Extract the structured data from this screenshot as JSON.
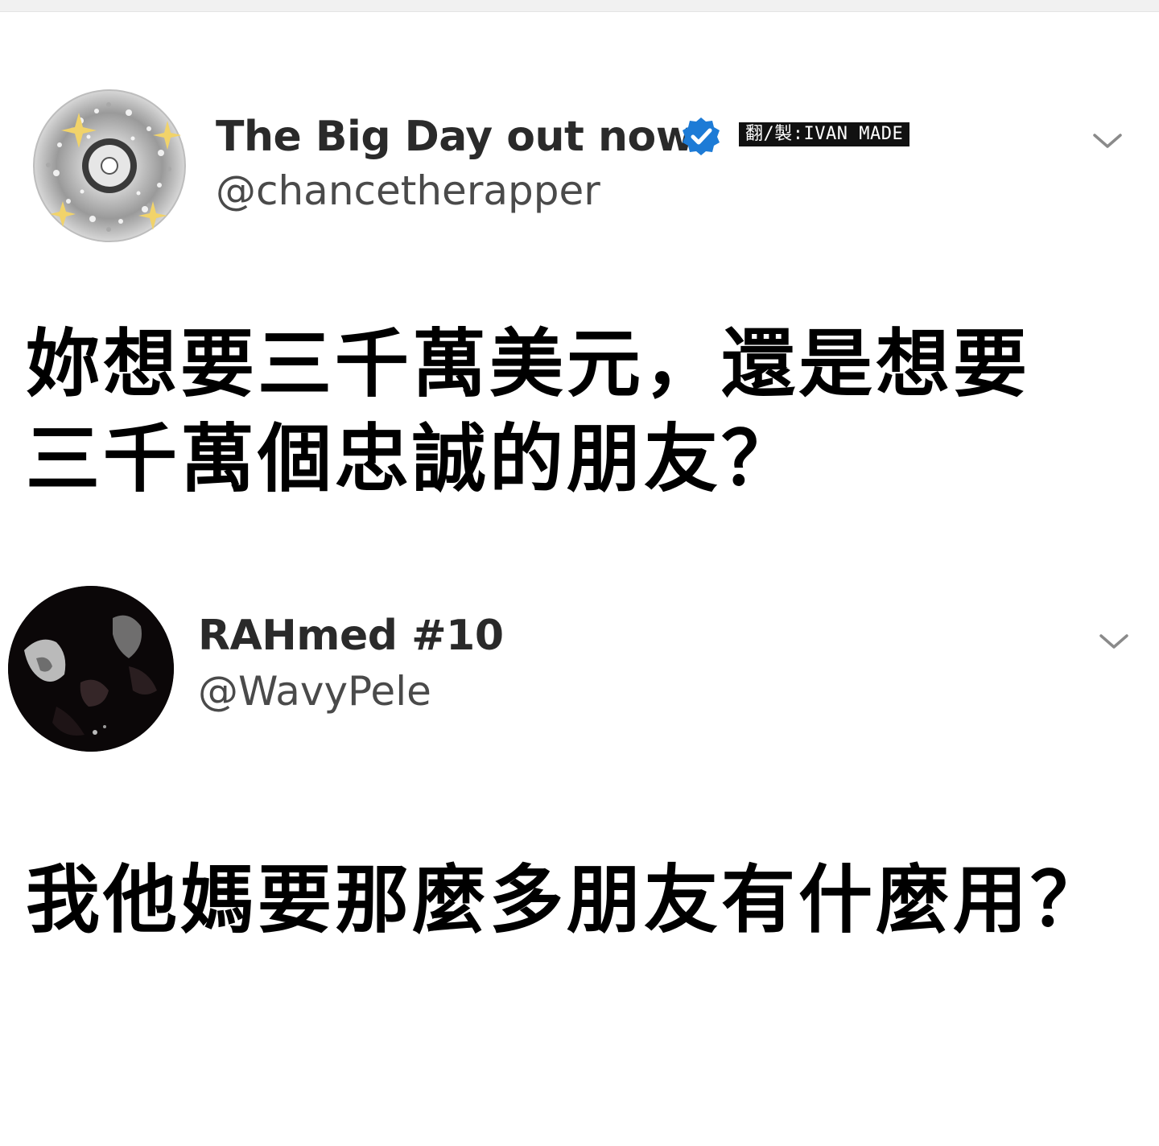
{
  "tweets": [
    {
      "display_name": "The Big Day out now",
      "handle": "@chancetherapper",
      "verified": true,
      "credit": "翻/製:IVAN MADE",
      "avatar_icon": "disc-sparkle-avatar",
      "text_lines": [
        "妳想要三千萬美元，還是想要",
        "三千萬個忠誠的朋友？"
      ]
    },
    {
      "display_name": "RAHmed #10",
      "handle": "@WavyPele",
      "verified": false,
      "avatar_icon": "dark-photo-avatar",
      "text_lines": [
        "我他媽要那麼多朋友有什麼用？"
      ]
    }
  ],
  "colors": {
    "verified_blue": "#1d7bd6",
    "name_text": "#2a2a2a",
    "handle_text": "#4a4a4a",
    "chevron": "#8a8a8a",
    "credit_bg": "#111111"
  },
  "icons": {
    "verified": "verified-badge-icon",
    "menu": "chevron-down-icon"
  }
}
